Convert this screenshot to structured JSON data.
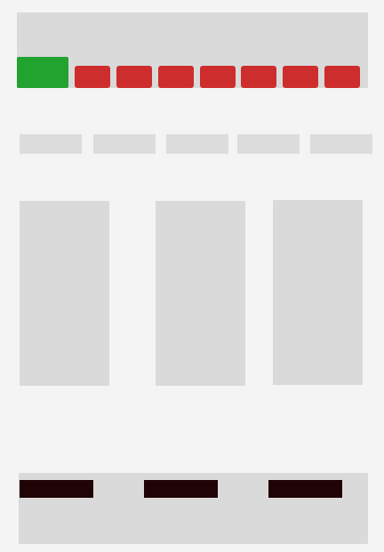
{
  "colors": {
    "active_tab": "#22a22f",
    "tab": "#cd2d2d",
    "footer_button": "#200306"
  },
  "header": {
    "tabs": [
      {
        "state": "active"
      },
      {
        "state": "inactive"
      },
      {
        "state": "inactive"
      },
      {
        "state": "inactive"
      },
      {
        "state": "inactive"
      },
      {
        "state": "inactive"
      },
      {
        "state": "inactive"
      },
      {
        "state": "inactive"
      }
    ]
  },
  "filters": {
    "chips": [
      {},
      {},
      {},
      {},
      {}
    ]
  },
  "content": {
    "cards": [
      {},
      {},
      {}
    ]
  },
  "footer": {
    "buttons": [
      {},
      {},
      {}
    ]
  }
}
